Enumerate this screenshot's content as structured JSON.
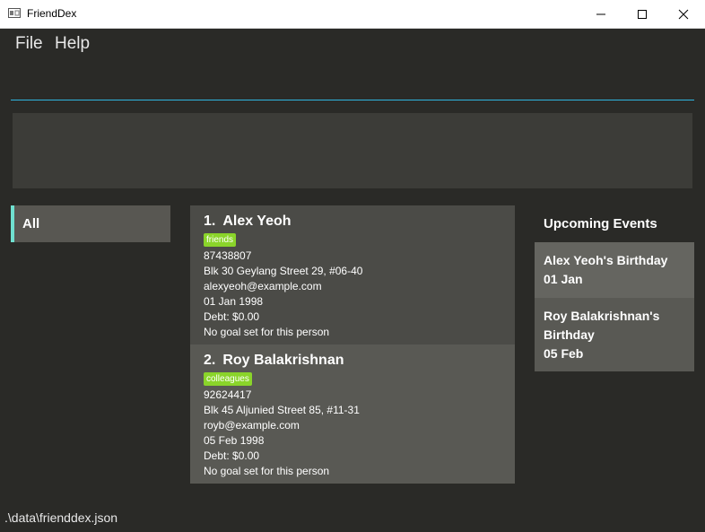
{
  "window": {
    "title": "FriendDex",
    "icon": "app-window-icon"
  },
  "menu": {
    "file": "File",
    "help": "Help"
  },
  "command": {
    "value": ""
  },
  "result": {
    "text": ""
  },
  "tabs": [
    {
      "label": "All"
    }
  ],
  "persons": [
    {
      "index": "1.",
      "name": "Alex Yeoh",
      "tag": "friends",
      "phone": "87438807",
      "address": "Blk 30 Geylang Street 29, #06-40",
      "email": "alexyeoh@example.com",
      "birthday": "01 Jan 1998",
      "debt": "Debt: $0.00",
      "goal": "No goal set for this person"
    },
    {
      "index": "2.",
      "name": "Roy Balakrishnan",
      "tag": "colleagues",
      "phone": "92624417",
      "address": "Blk 45 Aljunied Street 85, #11-31",
      "email": "royb@example.com",
      "birthday": "05 Feb 1998",
      "debt": "Debt: $0.00",
      "goal": "No goal set for this person"
    }
  ],
  "events": {
    "title": "Upcoming Events",
    "items": [
      {
        "name": "Alex Yeoh's Birthday",
        "date": "01 Jan"
      },
      {
        "name": "Roy Balakrishnan's Birthday",
        "date": "05 Feb"
      }
    ]
  },
  "status": {
    "path": ".\\data\\frienddex.json"
  },
  "colors": {
    "accent": "#2fb5e0",
    "tag": "#8ad42a",
    "tab_indicator": "#6fe0d0",
    "background": "#2a2a27"
  }
}
